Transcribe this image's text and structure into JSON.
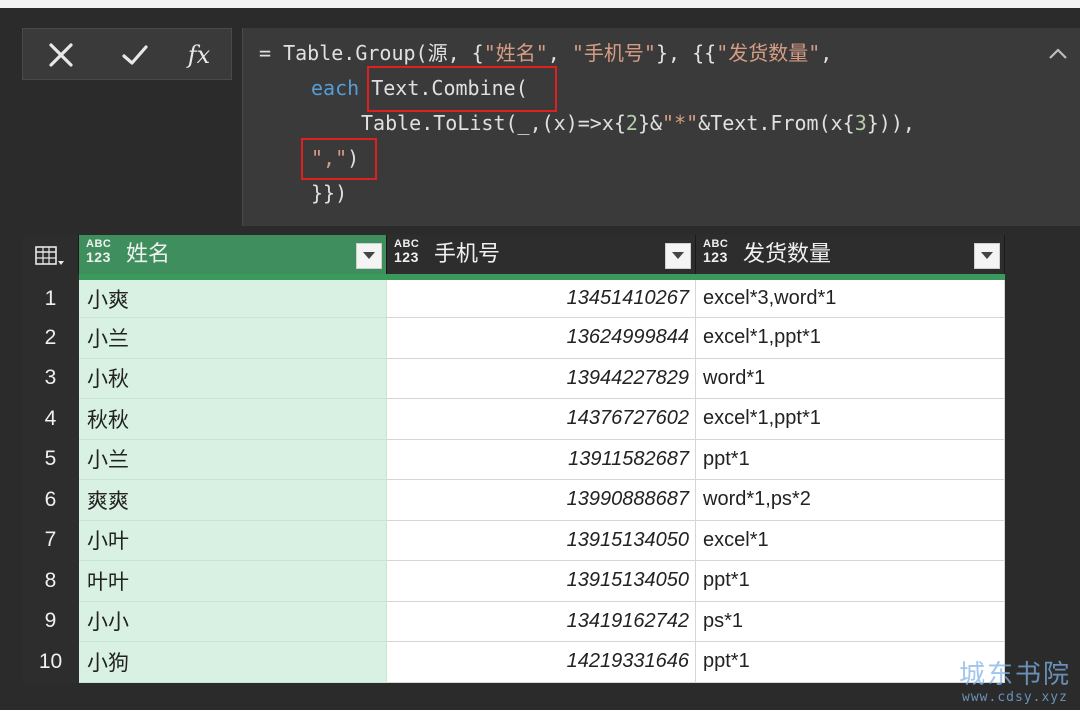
{
  "formula_bar": {
    "cancel_icon": "close-x-icon",
    "confirm_icon": "check-icon",
    "fx_label": "fx",
    "lines": [
      {
        "pre": "= Table.Group(源, {",
        "s1": "\"姓名\"",
        "mid": ", ",
        "s2": "\"手机号\"",
        "post": "}, {{",
        "s3": "\"发货数量\"",
        "end": ","
      },
      {
        "kw": "each",
        "rest": " Text.Combine("
      },
      {
        "a": "Table.ToList(_,(x)=>x{",
        "n1": "2",
        "b": "}&",
        "s": "\"*\"",
        "c": "&Text.From(x{",
        "n2": "3",
        "d": "})),"
      },
      {
        "s": "\",\"",
        "rest": ")"
      },
      {
        "text": "}})"
      }
    ],
    "highlight_color": "#e02020"
  },
  "table": {
    "columns": [
      {
        "type_top": "ABC",
        "type_bottom": "123",
        "title": "姓名"
      },
      {
        "type_top": "ABC",
        "type_bottom": "123",
        "title": "手机号"
      },
      {
        "type_top": "ABC",
        "type_bottom": "123",
        "title": "发货数量"
      }
    ],
    "rows": [
      {
        "n": "1",
        "name": "小爽",
        "phone": "13451410267",
        "qty": "excel*3,word*1"
      },
      {
        "n": "2",
        "name": "小兰",
        "phone": "13624999844",
        "qty": "excel*1,ppt*1"
      },
      {
        "n": "3",
        "name": "小秋",
        "phone": "13944227829",
        "qty": "word*1"
      },
      {
        "n": "4",
        "name": "秋秋",
        "phone": "14376727602",
        "qty": "excel*1,ppt*1"
      },
      {
        "n": "5",
        "name": "小兰",
        "phone": "13911582687",
        "qty": "ppt*1"
      },
      {
        "n": "6",
        "name": "爽爽",
        "phone": "13990888687",
        "qty": "word*1,ps*2"
      },
      {
        "n": "7",
        "name": "小叶",
        "phone": "13915134050",
        "qty": "excel*1"
      },
      {
        "n": "8",
        "name": "叶叶",
        "phone": "13915134050",
        "qty": "ppt*1"
      },
      {
        "n": "9",
        "name": "小小",
        "phone": "13419162742",
        "qty": "ps*1"
      },
      {
        "n": "10",
        "name": "小狗",
        "phone": "14219331646",
        "qty": "ppt*1"
      }
    ],
    "selected_column_color": "#3f8f5e",
    "selected_cell_color": "#d9f1e2"
  },
  "watermark": {
    "line1": "城东书院",
    "line2": "www.cdsy.xyz"
  }
}
